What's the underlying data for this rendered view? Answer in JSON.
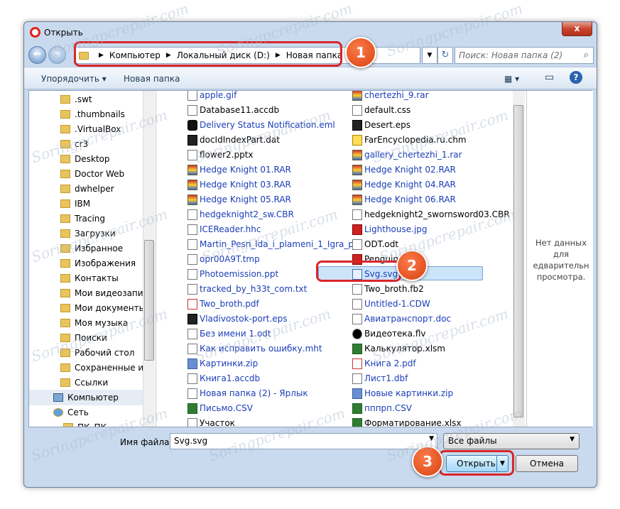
{
  "window": {
    "title": "Открыть",
    "close_label": "x"
  },
  "nav": {
    "back": "←",
    "forward": "→",
    "refresh": "↻"
  },
  "address": {
    "crumbs": [
      "Компьютер",
      "Локальный диск (D:)",
      "Новая папка (2)"
    ]
  },
  "search": {
    "placeholder": "Поиск: Новая папка (2)"
  },
  "toolbar": {
    "organize": "Упорядочить ▾",
    "new_folder": "Новая папка",
    "views": "▦ ▾",
    "pane": "▭",
    "help": "?"
  },
  "tree": [
    ".swt",
    ".thumbnails",
    ".VirtualBox",
    "cr3",
    "Desktop",
    "Doctor Web",
    "dwhelper",
    "IBM",
    "Tracing",
    "Загрузки",
    "Избранное",
    "Изображения",
    "Контакты",
    "Мои видеозапис",
    "Мои документы",
    "Моя музыка",
    "Поиски",
    "Рабочий стол",
    "Сохраненные иг",
    "Ссылки",
    "Компьютер",
    "Сеть",
    "ПК_ПК"
  ],
  "files_left": [
    {
      "name": "apple.gif",
      "type": "img",
      "blue": true
    },
    {
      "name": "Database11.accdb",
      "type": "doc",
      "blue": false
    },
    {
      "name": "Delivery Status Notification.eml",
      "type": "eml",
      "blue": true
    },
    {
      "name": "docIdIndexPart.dat",
      "type": "eps",
      "blue": false
    },
    {
      "name": "flower2.pptx",
      "type": "doc",
      "blue": false
    },
    {
      "name": "Hedge Knight 01.RAR",
      "type": "rar",
      "blue": true
    },
    {
      "name": "Hedge Knight 03.RAR",
      "type": "rar",
      "blue": true
    },
    {
      "name": "Hedge Knight 05.RAR",
      "type": "rar",
      "blue": true
    },
    {
      "name": "hedgeknight2_sw.CBR",
      "type": "doc",
      "blue": true
    },
    {
      "name": "ICEReader.hhc",
      "type": "doc",
      "blue": true
    },
    {
      "name": "Martin_Pesn_lda_i_plameni_1_Igra_p...",
      "type": "doc",
      "blue": true
    },
    {
      "name": "opr00A9T.tmp",
      "type": "doc",
      "blue": true
    },
    {
      "name": "Photoemission.ppt",
      "type": "doc",
      "blue": true
    },
    {
      "name": "tracked_by_h33t_com.txt",
      "type": "doc",
      "blue": true
    },
    {
      "name": "Two_broth.pdf",
      "type": "pdf",
      "blue": true
    },
    {
      "name": "Vladivostok-port.eps",
      "type": "eps",
      "blue": true
    },
    {
      "name": "Без имени 1.odt",
      "type": "doc",
      "blue": true
    },
    {
      "name": "Как исправить ошибку.mht",
      "type": "doc",
      "blue": true
    },
    {
      "name": "Картинки.zip",
      "type": "zip",
      "blue": true
    },
    {
      "name": "Книга1.accdb",
      "type": "doc",
      "blue": true
    },
    {
      "name": "Новая папка (2) - Ярлык",
      "type": "doc",
      "blue": true
    },
    {
      "name": "Письмо.CSV",
      "type": "xls",
      "blue": true
    },
    {
      "name": "Участок",
      "type": "doc",
      "blue": false
    }
  ],
  "files_right": [
    {
      "name": "chertezhi_9.rar",
      "type": "rar",
      "blue": true
    },
    {
      "name": "default.css",
      "type": "doc",
      "blue": false
    },
    {
      "name": "Desert.eps",
      "type": "eps",
      "blue": false
    },
    {
      "name": "FarEncyclopedia.ru.chm",
      "type": "chm",
      "blue": false
    },
    {
      "name": "gallery_chertezhi_1.rar",
      "type": "rar",
      "blue": true
    },
    {
      "name": "Hedge Knight 02.RAR",
      "type": "rar",
      "blue": true
    },
    {
      "name": "Hedge Knight 04.RAR",
      "type": "rar",
      "blue": true
    },
    {
      "name": "Hedge Knight 06.RAR",
      "type": "rar",
      "blue": true
    },
    {
      "name": "hedgeknight2_swornsword03.CBR",
      "type": "doc",
      "blue": false
    },
    {
      "name": "Lighthouse.jpg",
      "type": "jpg",
      "blue": true
    },
    {
      "name": "ODT.odt",
      "type": "doc",
      "blue": false
    },
    {
      "name": "Penguins.jpg",
      "type": "jpg",
      "blue": false
    },
    {
      "name": "Svg.svg",
      "type": "svg",
      "blue": true
    },
    {
      "name": "Two_broth.fb2",
      "type": "doc",
      "blue": false
    },
    {
      "name": "Untitled-1.CDW",
      "type": "doc",
      "blue": true
    },
    {
      "name": "Авиатранспорт.doc",
      "type": "doc",
      "blue": true
    },
    {
      "name": "Видеотека.flv",
      "type": "flv",
      "blue": false
    },
    {
      "name": "Калькулятор.xlsm",
      "type": "xls",
      "blue": false
    },
    {
      "name": "Книга 2.pdf",
      "type": "pdf",
      "blue": true
    },
    {
      "name": "Лист1.dbf",
      "type": "doc",
      "blue": true
    },
    {
      "name": "Новые картинки.zip",
      "type": "zip",
      "blue": true
    },
    {
      "name": "пппрп.CSV",
      "type": "xls",
      "blue": true
    },
    {
      "name": "Форматирование.xlsx",
      "type": "xls",
      "blue": false
    }
  ],
  "preview": {
    "text": "Нет данных для едварительн просмотра."
  },
  "filename": {
    "label": "Имя файла:",
    "value": "Svg.svg"
  },
  "filetype": {
    "value": "Все файлы"
  },
  "buttons": {
    "open": "Открыть",
    "cancel": "Отмена"
  },
  "badges": [
    "1",
    "2",
    "3"
  ],
  "watermark": "Soringpcrepair.com",
  "colors": {
    "highlight": "#d8262b",
    "badge": "#e8521c",
    "link": "#1a3db8"
  }
}
